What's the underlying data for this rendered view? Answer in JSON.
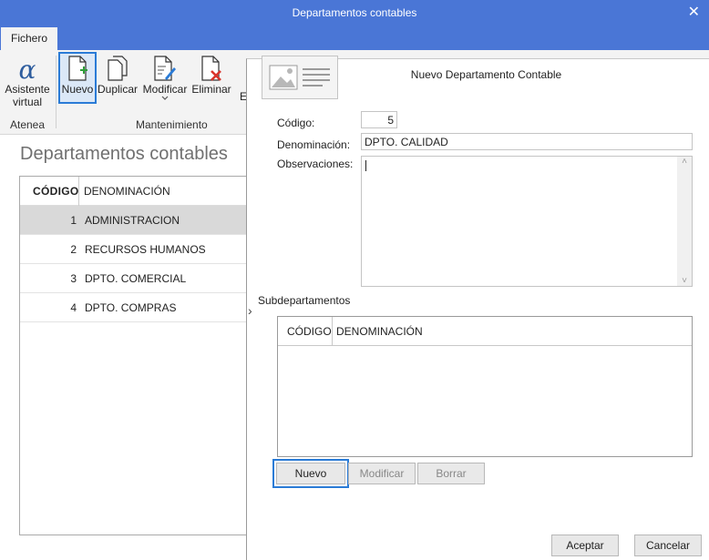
{
  "window": {
    "title": "Departamentos contables",
    "close_glyph": "✕"
  },
  "tabs": [
    {
      "label": "Fichero"
    }
  ],
  "ribbon": {
    "atenea": {
      "button_line1": "Asistente",
      "button_line2": "virtual",
      "group": "Atenea"
    },
    "mantenimiento": {
      "group": "Mantenimiento",
      "nuevo": "Nuevo",
      "duplicar": "Duplicar",
      "modificar": "Modificar",
      "eliminar": "Eliminar",
      "partial_letter": "E"
    },
    "icons": [
      "alpha-icon",
      "new-document-icon",
      "duplicate-icon",
      "edit-document-icon",
      "delete-document-icon"
    ]
  },
  "main": {
    "title": "Departamentos contables",
    "columns": {
      "code": "CÓDIGO",
      "name": "DENOMINACIÓN"
    },
    "rows": [
      {
        "code": "1",
        "name": "ADMINISTRACION"
      },
      {
        "code": "2",
        "name": "RECURSOS HUMANOS"
      },
      {
        "code": "3",
        "name": "DPTO. COMERCIAL"
      },
      {
        "code": "4",
        "name": "DPTO. COMPRAS"
      }
    ],
    "selected_row": 0
  },
  "dialog": {
    "title": "Nuevo Departamento Contable",
    "labels": {
      "codigo": "Código:",
      "denominacion": "Denominación:",
      "observaciones": "Observaciones:"
    },
    "values": {
      "codigo": "5",
      "denominacion": "DPTO. CALIDAD",
      "observaciones": ""
    },
    "sub_section": "Subdepartamentos",
    "sub_columns": {
      "code": "CÓDIGO",
      "name": "DENOMINACIÓN"
    },
    "sub_buttons": {
      "nuevo": "Nuevo",
      "modificar": "Modificar",
      "borrar": "Borrar"
    },
    "footer": {
      "aceptar": "Aceptar",
      "cancelar": "Cancelar"
    },
    "expand_glyph": "›",
    "scroll_up_glyph": "˄",
    "scroll_down_glyph": "˅"
  },
  "colors": {
    "titlebar": "#4a76d6",
    "accent": "#2a7bd6",
    "selected_row": "#d9d9d9",
    "ribbon_bg": "#f3f3f3"
  }
}
